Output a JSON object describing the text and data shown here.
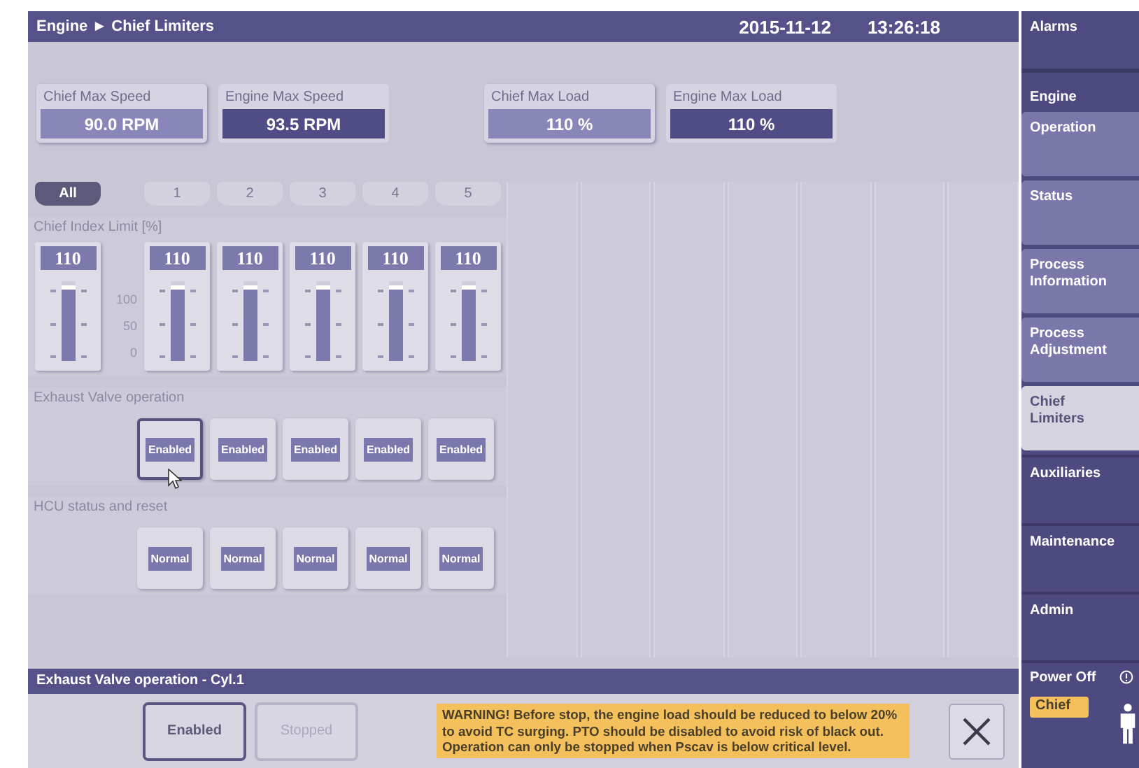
{
  "header": {
    "breadcrumb": "Engine ► Chief Limiters",
    "date": "2015-11-12",
    "time": "13:26:18"
  },
  "readouts": [
    {
      "kind": "chief",
      "label": "Chief Max Speed",
      "value": "90.0  RPM"
    },
    {
      "kind": "engine",
      "label": "Engine Max Speed",
      "value": "93.5 RPM"
    },
    {
      "kind": "chief",
      "label": "Chief Max Load",
      "value": "110 %"
    },
    {
      "kind": "engine",
      "label": "Engine Max Load",
      "value": "110 %"
    }
  ],
  "cylinder_tabs": [
    {
      "label": "All",
      "selected": true
    },
    {
      "label": "1",
      "selected": false
    },
    {
      "label": "2",
      "selected": false
    },
    {
      "label": "3",
      "selected": false
    },
    {
      "label": "4",
      "selected": false
    },
    {
      "label": "5",
      "selected": false
    }
  ],
  "index_limit": {
    "title": "Chief Index Limit [%]",
    "scale": [
      "100",
      "50",
      "0"
    ],
    "sliders": [
      {
        "value": "110",
        "level": 0.95
      },
      {
        "value": "110",
        "level": 0.95
      },
      {
        "value": "110",
        "level": 0.95
      },
      {
        "value": "110",
        "level": 0.95
      },
      {
        "value": "110",
        "level": 0.95
      },
      {
        "value": "110",
        "level": 0.95
      }
    ]
  },
  "exhaust_valve": {
    "title": "Exhaust Valve operation",
    "buttons": [
      {
        "label": "Enabled",
        "selected": true
      },
      {
        "label": "Enabled",
        "selected": false
      },
      {
        "label": "Enabled",
        "selected": false
      },
      {
        "label": "Enabled",
        "selected": false
      },
      {
        "label": "Enabled",
        "selected": false
      }
    ]
  },
  "hcu": {
    "title": "HCU status and reset",
    "buttons": [
      {
        "label": "Normal",
        "selected": false
      },
      {
        "label": "Normal",
        "selected": false
      },
      {
        "label": "Normal",
        "selected": false
      },
      {
        "label": "Normal",
        "selected": false
      },
      {
        "label": "Normal",
        "selected": false
      }
    ]
  },
  "bottom_panel": {
    "title": "Exhaust Valve operation - Cyl.1",
    "buttons": [
      {
        "label": "Enabled",
        "selected": true,
        "disabled": false
      },
      {
        "label": "Stopped",
        "selected": false,
        "disabled": true
      }
    ],
    "warning": "WARNING! Before stop, the engine load should be reduced to below 20% to avoid TC surging. PTO should be disabled to avoid risk of black out. Operation can only be stopped when Pscav is below critical level."
  },
  "sidebar": {
    "top": {
      "label": "Alarms"
    },
    "group": "Engine",
    "items": [
      {
        "label": "Operation",
        "selected": false,
        "kind": "sub"
      },
      {
        "label": "Status",
        "selected": false,
        "kind": "sub"
      },
      {
        "label": "Process Information",
        "selected": false,
        "kind": "sub"
      },
      {
        "label": "Process Adjustment",
        "selected": false,
        "kind": "sub"
      },
      {
        "label": "Chief Limiters",
        "selected": true,
        "kind": "sub"
      },
      {
        "label": "Auxiliaries",
        "selected": false,
        "kind": "main"
      },
      {
        "label": "Maintenance",
        "selected": false,
        "kind": "main"
      },
      {
        "label": "Admin",
        "selected": false,
        "kind": "main"
      }
    ],
    "power": "Power Off",
    "user": "Chief"
  }
}
